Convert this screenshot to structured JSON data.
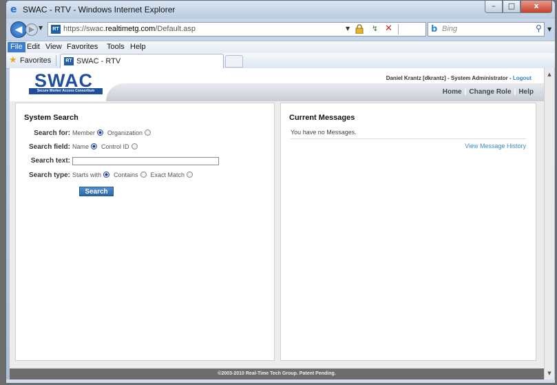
{
  "window": {
    "title": "SWAC - RTV - Windows Internet Explorer",
    "min_glyph": "–",
    "max_glyph": "□",
    "close_glyph": "x"
  },
  "addressbar": {
    "url_prefix": "https://swac.",
    "url_domain": "realtimetg.com",
    "url_path": "/Default.asp",
    "site_icon_text": "RT"
  },
  "searchbox": {
    "placeholder": "Bing"
  },
  "menubar": {
    "items": [
      "File",
      "Edit",
      "View",
      "Favorites",
      "Tools",
      "Help"
    ]
  },
  "favbar": {
    "favorites_label": "Favorites",
    "tab_title": "SWAC - RTV",
    "tab_icon_text": "RT"
  },
  "header": {
    "logo_text": "SWAC",
    "logo_subtitle": "Secure Worker Access Consortium",
    "user": "Daniel Krantz [dkrantz] - System Administrator - ",
    "logout": "Logout",
    "nav": [
      "Home",
      "Change Role",
      "Help"
    ]
  },
  "search_panel": {
    "title": "System Search",
    "search_for_label": "Search for:",
    "search_for_options": [
      "Member",
      "Organization"
    ],
    "search_field_label": "Search field:",
    "search_field_options": [
      "Name",
      "Control ID"
    ],
    "search_text_label": "Search text:",
    "search_text_value": "",
    "search_type_label": "Search type:",
    "search_type_options": [
      "Starts with",
      "Contains",
      "Exact Match"
    ],
    "search_button": "Search"
  },
  "messages_panel": {
    "title": "Current Messages",
    "empty_text": "You have no Messages.",
    "history_link": "View Message History"
  },
  "footer": {
    "text": "©2003-2010 Real-Time Tech Group. Patent Pending."
  }
}
